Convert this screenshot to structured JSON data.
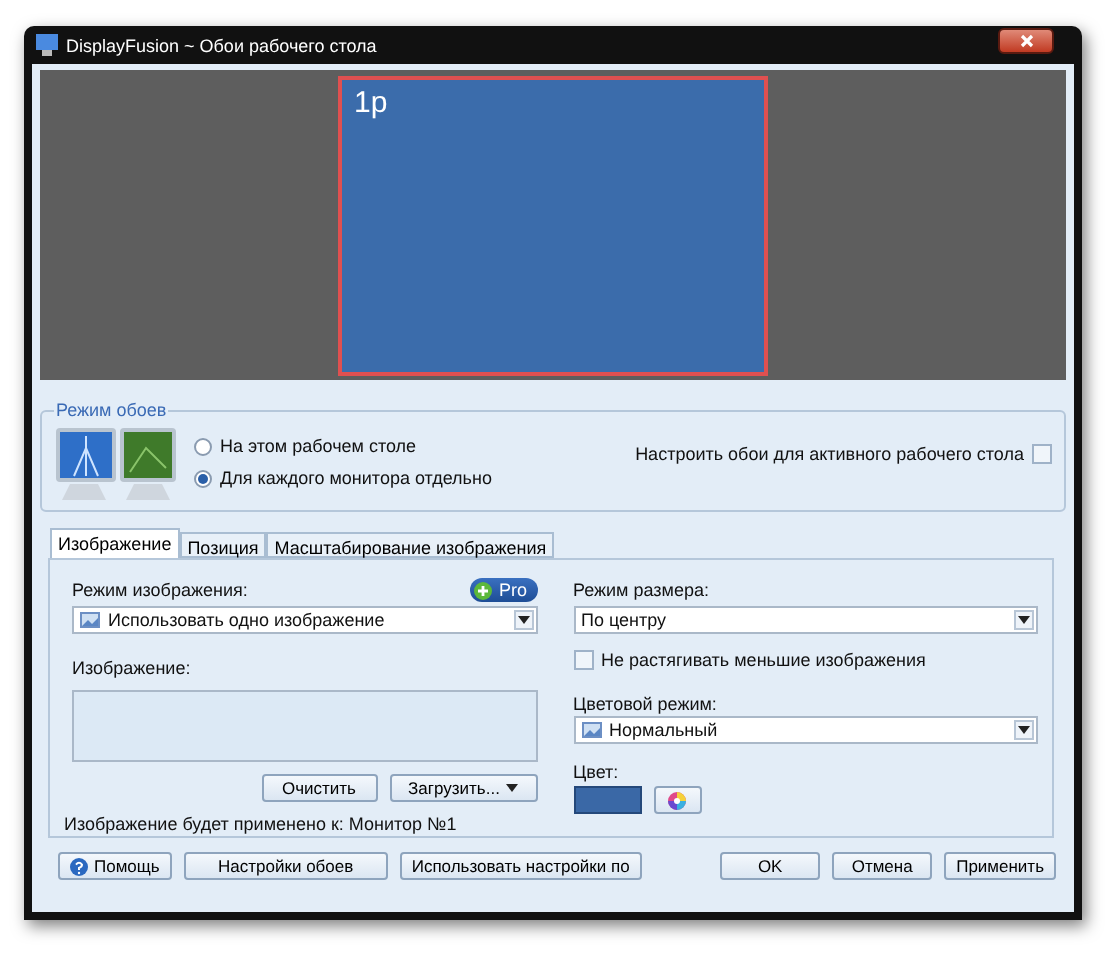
{
  "window": {
    "title": "DisplayFusion ~ Обои рабочего стола"
  },
  "preview": {
    "monitors": [
      {
        "label": "1p",
        "selected": true
      }
    ]
  },
  "wallpaper_mode": {
    "title": "Режим обоев",
    "options": [
      {
        "label": "На этом рабочем столе",
        "selected": false
      },
      {
        "label": "Для каждого монитора отдельно",
        "selected": true
      }
    ],
    "active_desktop": {
      "label": "Настроить обои для активного рабочего стола",
      "checked": false
    }
  },
  "tabs": [
    {
      "label": "Изображение",
      "selected": true
    },
    {
      "label": "Позиция",
      "selected": false
    },
    {
      "label": "Масштабирование изображения",
      "selected": false
    }
  ],
  "image_panel": {
    "image_mode_label": "Режим изображения:",
    "pro_badge": "Pro",
    "image_mode_value": "Использовать одно изображение",
    "image_label": "Изображение:",
    "clear_button": "Очистить",
    "load_button": "Загрузить...",
    "applied_note": "Изображение будет применено к: Монитор №1"
  },
  "size_panel": {
    "size_mode_label": "Режим размера:",
    "size_mode_value": "По центру",
    "no_stretch": {
      "label": "Не растягивать меньшие изображения",
      "checked": false
    },
    "color_mode_label": "Цветовой режим:",
    "color_mode_value": "Нормальный",
    "color_label": "Цвет:",
    "color": "#3a68a6"
  },
  "footer": {
    "help_button": "Помощь",
    "left_buttons": [
      "Настройки обоев",
      "Использовать настройки по"
    ],
    "right_buttons": [
      "OK",
      "Отмена",
      "Применить"
    ]
  }
}
